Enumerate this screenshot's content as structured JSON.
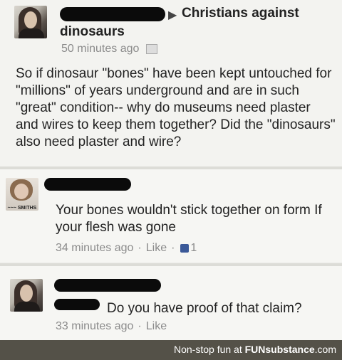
{
  "post": {
    "group_label": "Christians against",
    "group_label2": "dinosaurs",
    "time": "50 minutes ago",
    "text": "So if dinosaur \"bones\" have been kept untouched for \"millions\" of years underground and are in such \"great\" condition-- why do museums need plaster and wires to keep them together? Did the \"dinosaurs\" also need plaster and wire?"
  },
  "comments": [
    {
      "avatar_caption": "~~~ SMITHS",
      "text": "Your bones wouldn't stick together on form If your flesh was gone",
      "time": "34 minutes ago",
      "like": "Like",
      "like_count": "1"
    },
    {
      "text": "Do you have proof of that claim?",
      "time": "33 minutes ago",
      "like": "Like"
    }
  ],
  "footer": {
    "tagline": "Non-stop fun at",
    "brand": "FUNsubstance",
    "domain": ".com"
  }
}
